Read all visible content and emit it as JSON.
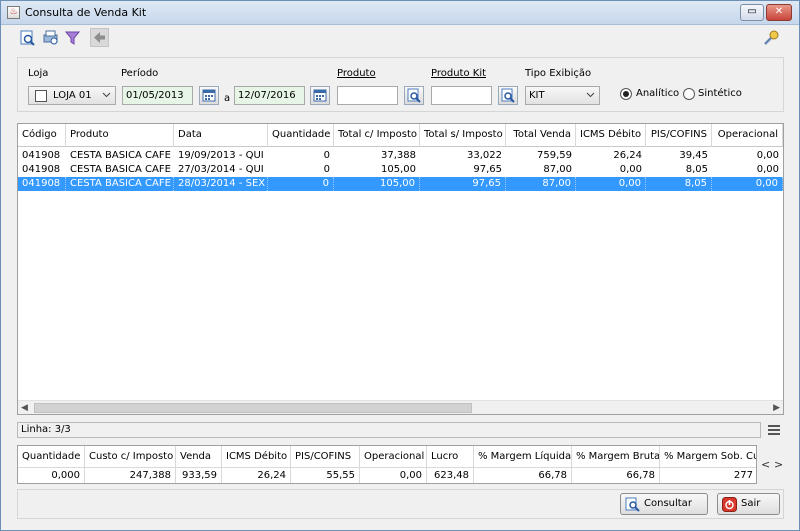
{
  "window": {
    "title": "Consulta de Venda Kit",
    "min_glyph": "▭",
    "close_glyph": "✕",
    "app_icon_glyph": "♨"
  },
  "toolbar": {
    "icons": [
      "search-doc-icon",
      "print-icon",
      "filter-icon",
      "back-arrow-icon",
      "key-icon"
    ]
  },
  "filters": {
    "loja_label": "Loja",
    "loja_value": "LOJA 01",
    "periodo_label": "Período",
    "date_from": "01/05/2013",
    "date_sep": "a",
    "date_to": "12/07/2016",
    "produto_label": "Produto",
    "produto_value": "",
    "produto_kit_label": "Produto Kit",
    "produto_kit_value": "",
    "tipo_label": "Tipo Exibição",
    "tipo_value": "KIT",
    "radio_analitico": "Analítico",
    "radio_sintetico": "Sintético",
    "selected_mode": "Analítico"
  },
  "grid": {
    "columns": [
      "Código",
      "Produto",
      "Data",
      "Quantidade",
      "Total c/ Imposto",
      "Total s/ Imposto",
      "Total Venda",
      "ICMS Débito",
      "PIS/COFINS",
      "Operacional"
    ],
    "rows": [
      [
        "041908",
        "CESTA BASICA CAFE",
        "19/09/2013 - QUI",
        "0",
        "37,388",
        "33,022",
        "759,59",
        "26,24",
        "39,45",
        "0,00"
      ],
      [
        "041908",
        "CESTA BASICA CAFE",
        "27/03/2014 - QUI",
        "0",
        "105,00",
        "97,65",
        "87,00",
        "0,00",
        "8,05",
        "0,00"
      ],
      [
        "041908",
        "CESTA BASICA CAFE",
        "28/03/2014 - SEX",
        "0",
        "105,00",
        "97,65",
        "87,00",
        "0,00",
        "8,05",
        "0,00"
      ]
    ],
    "selected_row": 2
  },
  "status": {
    "linha": "Linha: 3/3"
  },
  "totals": {
    "columns": [
      "Quantidade",
      "Custo c/ Imposto",
      "Venda",
      "ICMS Débito",
      "PIS/COFINS",
      "Operacional",
      "Lucro",
      "% Margem Líquida",
      "% Margem Bruta",
      "% Margem Sob. Custo"
    ],
    "values": [
      "0,000",
      "247,388",
      "933,59",
      "26,24",
      "55,55",
      "0,00",
      "623,48",
      "66,78",
      "66,78",
      "277"
    ],
    "nav_left": "<",
    "nav_right": ">"
  },
  "actions": {
    "consultar": "Consultar",
    "sair": "Sair"
  },
  "colors": {
    "selection": "#3399ff",
    "date_field_bg": "#e6f5e6",
    "sair_red": "#d9382c"
  }
}
